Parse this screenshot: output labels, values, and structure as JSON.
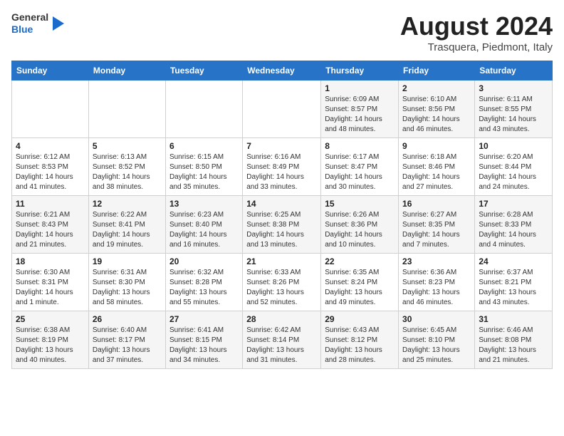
{
  "header": {
    "logo_line1": "General",
    "logo_line2": "Blue",
    "month_title": "August 2024",
    "location": "Trasquera, Piedmont, Italy"
  },
  "weekdays": [
    "Sunday",
    "Monday",
    "Tuesday",
    "Wednesday",
    "Thursday",
    "Friday",
    "Saturday"
  ],
  "weeks": [
    [
      {
        "day": "",
        "info": ""
      },
      {
        "day": "",
        "info": ""
      },
      {
        "day": "",
        "info": ""
      },
      {
        "day": "",
        "info": ""
      },
      {
        "day": "1",
        "info": "Sunrise: 6:09 AM\nSunset: 8:57 PM\nDaylight: 14 hours\nand 48 minutes."
      },
      {
        "day": "2",
        "info": "Sunrise: 6:10 AM\nSunset: 8:56 PM\nDaylight: 14 hours\nand 46 minutes."
      },
      {
        "day": "3",
        "info": "Sunrise: 6:11 AM\nSunset: 8:55 PM\nDaylight: 14 hours\nand 43 minutes."
      }
    ],
    [
      {
        "day": "4",
        "info": "Sunrise: 6:12 AM\nSunset: 8:53 PM\nDaylight: 14 hours\nand 41 minutes."
      },
      {
        "day": "5",
        "info": "Sunrise: 6:13 AM\nSunset: 8:52 PM\nDaylight: 14 hours\nand 38 minutes."
      },
      {
        "day": "6",
        "info": "Sunrise: 6:15 AM\nSunset: 8:50 PM\nDaylight: 14 hours\nand 35 minutes."
      },
      {
        "day": "7",
        "info": "Sunrise: 6:16 AM\nSunset: 8:49 PM\nDaylight: 14 hours\nand 33 minutes."
      },
      {
        "day": "8",
        "info": "Sunrise: 6:17 AM\nSunset: 8:47 PM\nDaylight: 14 hours\nand 30 minutes."
      },
      {
        "day": "9",
        "info": "Sunrise: 6:18 AM\nSunset: 8:46 PM\nDaylight: 14 hours\nand 27 minutes."
      },
      {
        "day": "10",
        "info": "Sunrise: 6:20 AM\nSunset: 8:44 PM\nDaylight: 14 hours\nand 24 minutes."
      }
    ],
    [
      {
        "day": "11",
        "info": "Sunrise: 6:21 AM\nSunset: 8:43 PM\nDaylight: 14 hours\nand 21 minutes."
      },
      {
        "day": "12",
        "info": "Sunrise: 6:22 AM\nSunset: 8:41 PM\nDaylight: 14 hours\nand 19 minutes."
      },
      {
        "day": "13",
        "info": "Sunrise: 6:23 AM\nSunset: 8:40 PM\nDaylight: 14 hours\nand 16 minutes."
      },
      {
        "day": "14",
        "info": "Sunrise: 6:25 AM\nSunset: 8:38 PM\nDaylight: 14 hours\nand 13 minutes."
      },
      {
        "day": "15",
        "info": "Sunrise: 6:26 AM\nSunset: 8:36 PM\nDaylight: 14 hours\nand 10 minutes."
      },
      {
        "day": "16",
        "info": "Sunrise: 6:27 AM\nSunset: 8:35 PM\nDaylight: 14 hours\nand 7 minutes."
      },
      {
        "day": "17",
        "info": "Sunrise: 6:28 AM\nSunset: 8:33 PM\nDaylight: 14 hours\nand 4 minutes."
      }
    ],
    [
      {
        "day": "18",
        "info": "Sunrise: 6:30 AM\nSunset: 8:31 PM\nDaylight: 14 hours\nand 1 minute."
      },
      {
        "day": "19",
        "info": "Sunrise: 6:31 AM\nSunset: 8:30 PM\nDaylight: 13 hours\nand 58 minutes."
      },
      {
        "day": "20",
        "info": "Sunrise: 6:32 AM\nSunset: 8:28 PM\nDaylight: 13 hours\nand 55 minutes."
      },
      {
        "day": "21",
        "info": "Sunrise: 6:33 AM\nSunset: 8:26 PM\nDaylight: 13 hours\nand 52 minutes."
      },
      {
        "day": "22",
        "info": "Sunrise: 6:35 AM\nSunset: 8:24 PM\nDaylight: 13 hours\nand 49 minutes."
      },
      {
        "day": "23",
        "info": "Sunrise: 6:36 AM\nSunset: 8:23 PM\nDaylight: 13 hours\nand 46 minutes."
      },
      {
        "day": "24",
        "info": "Sunrise: 6:37 AM\nSunset: 8:21 PM\nDaylight: 13 hours\nand 43 minutes."
      }
    ],
    [
      {
        "day": "25",
        "info": "Sunrise: 6:38 AM\nSunset: 8:19 PM\nDaylight: 13 hours\nand 40 minutes."
      },
      {
        "day": "26",
        "info": "Sunrise: 6:40 AM\nSunset: 8:17 PM\nDaylight: 13 hours\nand 37 minutes."
      },
      {
        "day": "27",
        "info": "Sunrise: 6:41 AM\nSunset: 8:15 PM\nDaylight: 13 hours\nand 34 minutes."
      },
      {
        "day": "28",
        "info": "Sunrise: 6:42 AM\nSunset: 8:14 PM\nDaylight: 13 hours\nand 31 minutes."
      },
      {
        "day": "29",
        "info": "Sunrise: 6:43 AM\nSunset: 8:12 PM\nDaylight: 13 hours\nand 28 minutes."
      },
      {
        "day": "30",
        "info": "Sunrise: 6:45 AM\nSunset: 8:10 PM\nDaylight: 13 hours\nand 25 minutes."
      },
      {
        "day": "31",
        "info": "Sunrise: 6:46 AM\nSunset: 8:08 PM\nDaylight: 13 hours\nand 21 minutes."
      }
    ]
  ]
}
